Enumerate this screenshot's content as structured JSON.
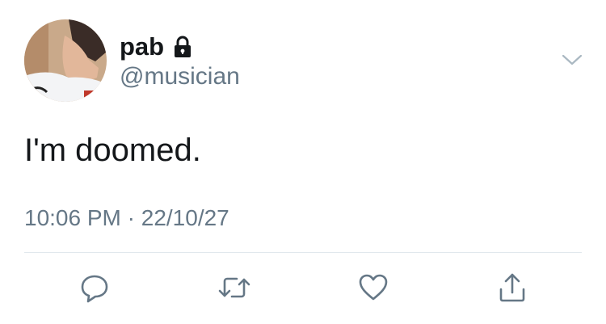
{
  "user": {
    "display_name": "pab",
    "handle": "@musician",
    "locked": true
  },
  "tweet": {
    "text": "I'm doomed.",
    "time": "10:06 PM",
    "separator": "·",
    "date": "22/10/27"
  },
  "actions": [
    {
      "icon": "reply-icon"
    },
    {
      "icon": "retweet-icon"
    },
    {
      "icon": "like-icon"
    },
    {
      "icon": "share-icon"
    }
  ],
  "colors": {
    "text": "#14171a",
    "secondary": "#657786",
    "icon": "#657786",
    "divider": "#e1e8ed"
  }
}
